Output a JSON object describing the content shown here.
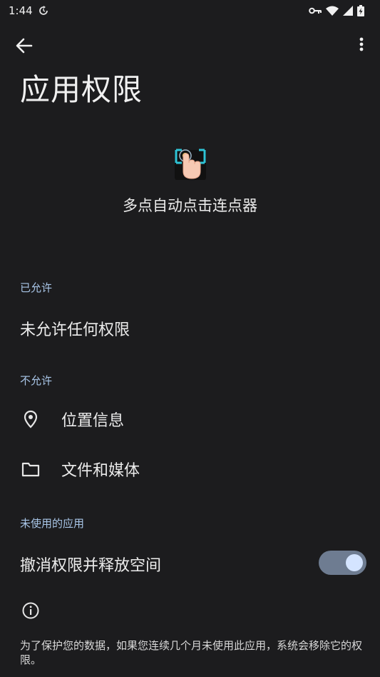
{
  "status_bar": {
    "time": "1:44"
  },
  "app_bar": {
    "back_icon": "arrow-left-icon",
    "more_icon": "more-vert-icon"
  },
  "page": {
    "title": "应用权限"
  },
  "app": {
    "icon": "tap-hand-icon",
    "name": "多点自动点击连点器"
  },
  "sections": {
    "allowed": {
      "header": "已允许",
      "empty_text": "未允许任何权限"
    },
    "not_allowed": {
      "header": "不允许",
      "items": [
        {
          "icon": "location-pin-icon",
          "label": "位置信息"
        },
        {
          "icon": "folder-icon",
          "label": "文件和媒体"
        }
      ]
    },
    "unused_apps": {
      "header": "未使用的应用",
      "toggle_label": "撤消权限并释放空间",
      "toggle_on": true
    }
  },
  "footer": {
    "info_icon": "info-icon",
    "text": "为了保护您的数据，如果您连续几个月未使用此应用，系统会移除它的权限。"
  },
  "colors": {
    "background": "#1c1c1e",
    "section_header": "#a9c6e8",
    "toggle_track": "#6e7c91",
    "toggle_knob": "#d4e4ff"
  }
}
